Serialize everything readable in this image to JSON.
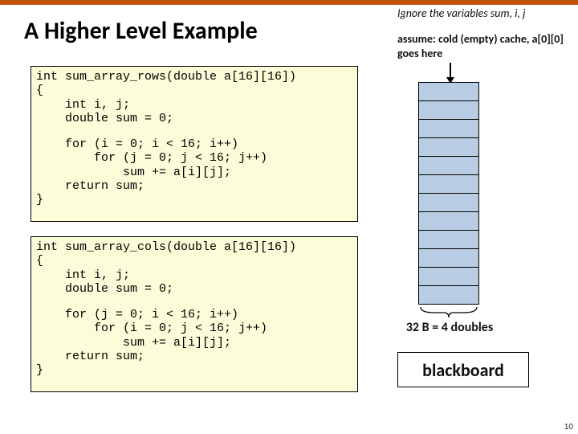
{
  "title": "A Higher Level Example",
  "note_top": "Ignore the variables sum, i, j",
  "assume": "assume: cold (empty) cache, a[0][0] goes here",
  "code_rows": {
    "l1": "int sum_array_rows(double a[16][16])",
    "l2": "{",
    "l3": "    int i, j;",
    "l4": "    double sum = 0;",
    "l5": "    for (i = 0; i < 16; i++)",
    "l6": "        for (j = 0; j < 16; j++)",
    "l7": "            sum += a[i][j];",
    "l8": "    return sum;",
    "l9": "}"
  },
  "code_cols": {
    "l1": "int sum_array_cols(double a[16][16])",
    "l2": "{",
    "l3": "    int i, j;",
    "l4": "    double sum = 0;",
    "l5": "    for (j = 0; i < 16; i++)",
    "l6": "        for (i = 0; j < 16; j++)",
    "l7": "            sum += a[i][j];",
    "l8": "    return sum;",
    "l9": "}"
  },
  "cache": {
    "rows": 12
  },
  "brace_label": "32 B = 4 doubles",
  "blackboard": "blackboard",
  "pagenum": "10"
}
